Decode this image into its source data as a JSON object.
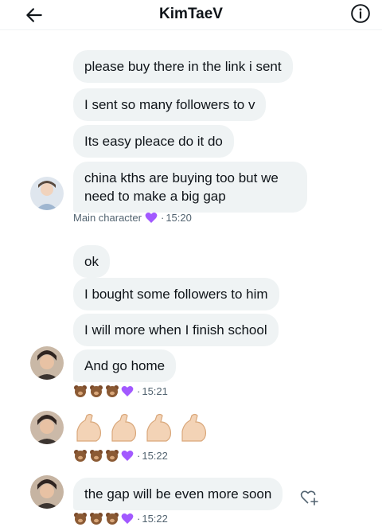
{
  "header": {
    "title": "KimTaeV",
    "back_icon": "arrow-left-icon",
    "info_icon": "info-circle-icon"
  },
  "messages": [
    {
      "text": "please buy there in the link i sent"
    },
    {
      "text": "I sent so many followers to v"
    },
    {
      "text": "Its easy pleace do it do"
    },
    {
      "text": "china kths are buying too but we need to make a big gap"
    },
    {
      "text": "ok"
    },
    {
      "text": "I bought some followers to him"
    },
    {
      "text": "I will more when I finish school"
    },
    {
      "text": "And go home"
    },
    {
      "text": "the gap will be even more soon"
    }
  ],
  "meta": {
    "sender_name": "Main character",
    "time_1": "15:20",
    "time_2": "15:21",
    "time_3": "15:22",
    "time_4": "15:22",
    "separator": "·"
  },
  "icons": {
    "bear": "bear-face-icon",
    "heart": "purple-heart-icon",
    "muscle": "flexed-biceps-icon",
    "add_reaction": "add-reaction-icon"
  },
  "colors": {
    "bubble_bg": "#eff3f4",
    "heart": "#a259ff",
    "muted_text": "#536471"
  }
}
